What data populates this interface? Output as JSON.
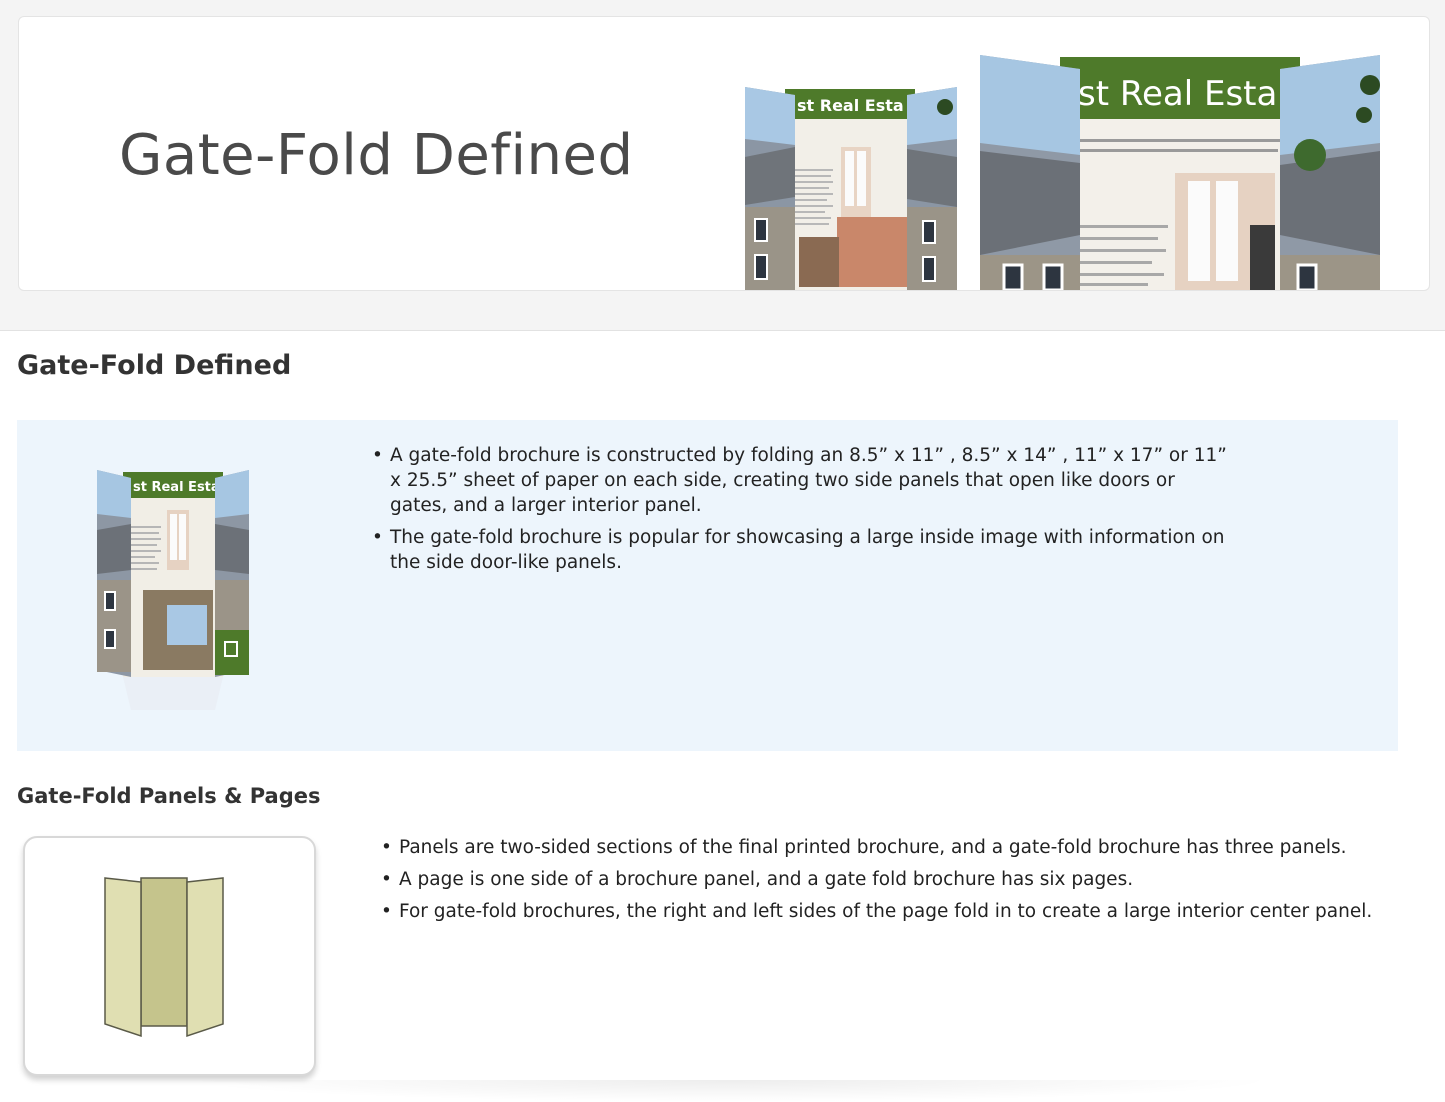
{
  "hero": {
    "title": "Gate-Fold Defined",
    "brochure_heading": "st Real Esta"
  },
  "section1": {
    "title": "Gate-Fold Defined",
    "bullets": [
      "A gate-fold brochure is constructed by folding an 8.5”   x 11”  , 8.5”   x 14”  , 11”   x 17”  or 11”   x 25.5”   sheet of paper on each side, creating two side panels that open like doors or gates, and a larger interior panel.",
      "The gate-fold brochure is popular for showcasing a large inside image with information on the side door-like panels."
    ]
  },
  "section2": {
    "title": "Gate-Fold Panels & Pages",
    "bullets": [
      "Panels are two-sided sections of the final printed brochure, and a gate-fold brochure has three panels.",
      "A page is one side of a brochure panel, and a gate fold brochure has six pages.",
      "For gate-fold brochures, the right and left sides of the page fold in to create a large interior center panel."
    ]
  },
  "colors": {
    "info_box_bg": "#edf5fc",
    "brochure_green": "#4e7a2a",
    "diagram_center": "#c5c48c",
    "diagram_side": "#e0dfb2"
  }
}
